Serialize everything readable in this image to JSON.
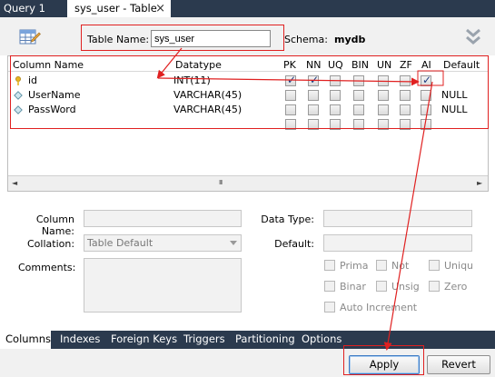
{
  "tabs": [
    {
      "label": "Query 1"
    },
    {
      "label": "sys_user - Table"
    }
  ],
  "tab_close_glyph": "×",
  "header": {
    "table_name_label": "Table Name:",
    "table_name_value": "sys_user",
    "schema_label": "Schema:",
    "schema_value": "mydb"
  },
  "grid": {
    "columns": [
      "Column Name",
      "Datatype",
      "PK",
      "NN",
      "UQ",
      "BIN",
      "UN",
      "ZF",
      "AI",
      "Default"
    ],
    "rows": [
      {
        "name": "id",
        "datatype": "INT(11)",
        "key": true,
        "flags": [
          true,
          true,
          false,
          false,
          false,
          false,
          true
        ],
        "default": ""
      },
      {
        "name": "UserName",
        "datatype": "VARCHAR(45)",
        "key": false,
        "flags": [
          false,
          false,
          false,
          false,
          false,
          false,
          false
        ],
        "default": "NULL"
      },
      {
        "name": "PassWord",
        "datatype": "VARCHAR(45)",
        "key": false,
        "flags": [
          false,
          false,
          false,
          false,
          false,
          false,
          false
        ],
        "default": "NULL"
      },
      {
        "name": "",
        "datatype": "",
        "key": false,
        "flags": [
          false,
          false,
          false,
          false,
          false,
          false,
          false
        ],
        "default": ""
      }
    ],
    "scroll_left": "◄",
    "scroll_right": "►",
    "scroll_thumb": "III"
  },
  "details": {
    "column_name_label": "Column Name:",
    "collation_label": "Collation:",
    "collation_value": "Table Default",
    "comments_label": "Comments:",
    "data_type_label": "Data Type:",
    "default_label": "Default:",
    "options": {
      "prima": "Prima",
      "not": "Not",
      "uniq": "Uniqu",
      "binar": "Binar",
      "unsig": "Unsig",
      "zero": "Zero",
      "auto_increment": "Auto Increment"
    }
  },
  "bottom_tabs": [
    "Columns",
    "Indexes",
    "Foreign Keys",
    "Triggers",
    "Partitioning",
    "Options"
  ],
  "buttons": {
    "apply": "Apply",
    "revert": "Revert"
  },
  "colors": {
    "annotation": "#e02020",
    "tabbar": "#2b3a4e",
    "checkmark": "#1d3c80"
  }
}
